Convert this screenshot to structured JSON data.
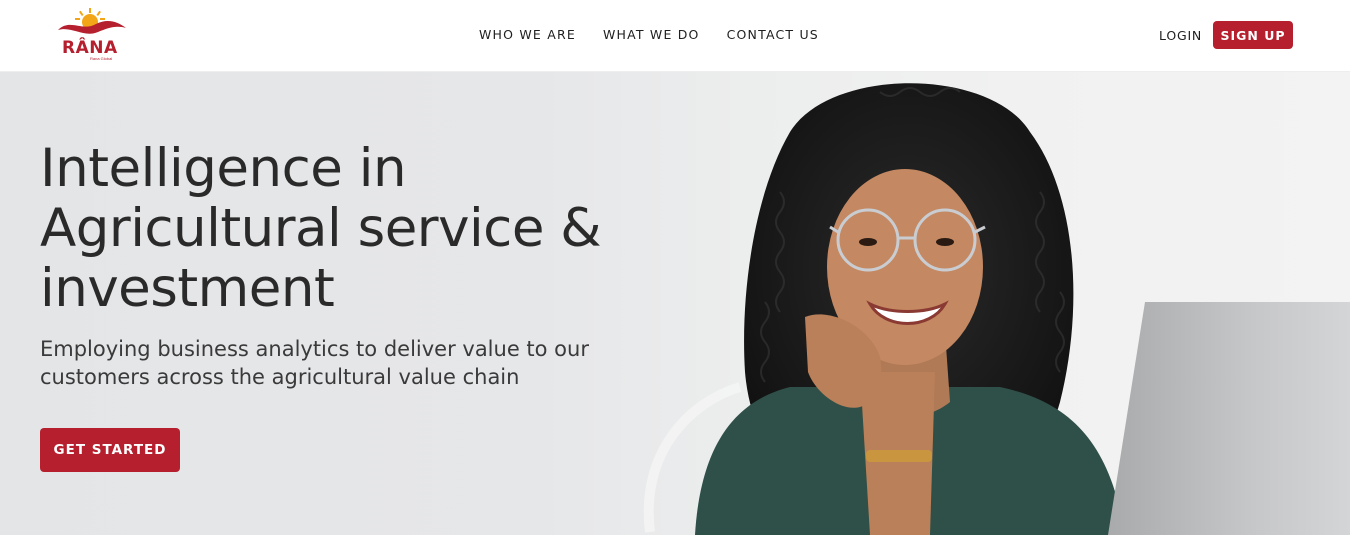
{
  "brand": {
    "logo_text": "RÂNA",
    "logo_subtext": "Rana Global",
    "colors": {
      "primary": "#b51f2e",
      "sun": "#f2a516"
    }
  },
  "nav": {
    "items": [
      {
        "label": "WHO WE ARE"
      },
      {
        "label": "WHAT WE DO"
      },
      {
        "label": "CONTACT US"
      }
    ]
  },
  "auth": {
    "login_label": "LOGIN",
    "signup_label": "SIGN UP"
  },
  "hero": {
    "title": "Intelligence in Agricultural service & investment",
    "subtitle": "Employing business analytics to deliver value to our customers across the agricultural value chain",
    "cta_label": "GET STARTED"
  }
}
